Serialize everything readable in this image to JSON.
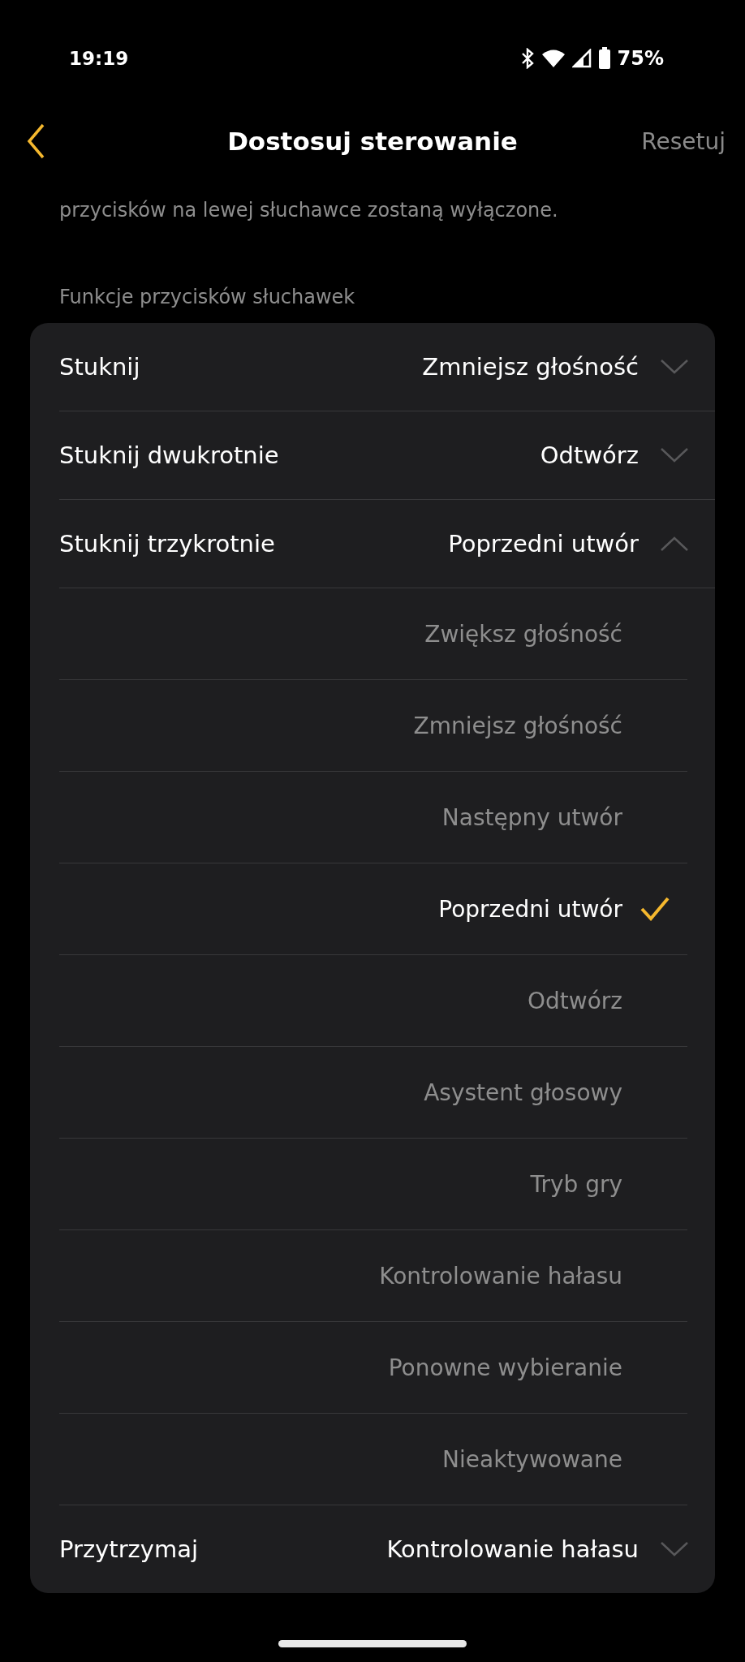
{
  "status_bar": {
    "time": "19:19",
    "battery": "75%"
  },
  "header": {
    "title": "Dostosuj sterowanie",
    "action": "Resetuj"
  },
  "description": "przycisków na lewej słuchawce zostaną wyłączone.",
  "section_label": "Funkcje przycisków słuchawek",
  "controls": [
    {
      "label": "Stuknij",
      "value": "Zmniejsz głośność",
      "expanded": false
    },
    {
      "label": "Stuknij dwukrotnie",
      "value": "Odtwórz",
      "expanded": false
    },
    {
      "label": "Stuknij trzykrotnie",
      "value": "Poprzedni utwór",
      "expanded": true,
      "options": [
        {
          "label": "Zwiększ głośność",
          "selected": false
        },
        {
          "label": "Zmniejsz głośność",
          "selected": false
        },
        {
          "label": "Następny utwór",
          "selected": false
        },
        {
          "label": "Poprzedni utwór",
          "selected": true
        },
        {
          "label": "Odtwórz",
          "selected": false
        },
        {
          "label": "Asystent głosowy",
          "selected": false
        },
        {
          "label": "Tryb gry",
          "selected": false
        },
        {
          "label": "Kontrolowanie hałasu",
          "selected": false
        },
        {
          "label": "Ponowne wybieranie",
          "selected": false
        },
        {
          "label": "Nieaktywowane",
          "selected": false
        }
      ]
    },
    {
      "label": "Przytrzymaj",
      "value": "Kontrolowanie hałasu",
      "expanded": false
    }
  ]
}
